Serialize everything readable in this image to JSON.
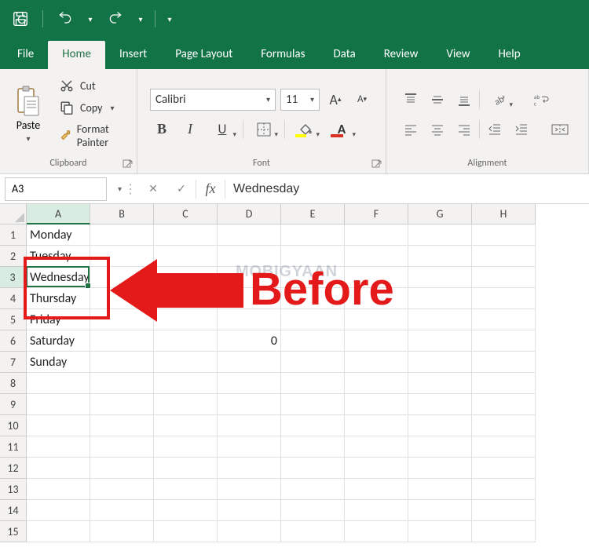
{
  "tabs": {
    "file": "File",
    "home": "Home",
    "insert": "Insert",
    "page_layout": "Page Layout",
    "formulas": "Formulas",
    "data": "Data",
    "review": "Review",
    "view": "View",
    "help": "Help"
  },
  "ribbon": {
    "clipboard": {
      "paste": "Paste",
      "cut": "Cut",
      "copy": "Copy",
      "format_painter": "Format Painter",
      "label": "Clipboard"
    },
    "font": {
      "name": "Calibri",
      "size": "11",
      "label": "Font"
    },
    "alignment": {
      "label": "Alignment"
    }
  },
  "formula_bar": {
    "name_box": "A3",
    "value": "Wednesday"
  },
  "grid": {
    "columns": [
      "A",
      "B",
      "C",
      "D",
      "E",
      "F",
      "G",
      "H"
    ],
    "row_count": 15,
    "selected_col": "A",
    "selected_row": 3,
    "cells": [
      {
        "row": 1,
        "col": "A",
        "value": "Monday"
      },
      {
        "row": 2,
        "col": "A",
        "value": "Tuesday"
      },
      {
        "row": 3,
        "col": "A",
        "value": "Wednesday"
      },
      {
        "row": 4,
        "col": "A",
        "value": "Thursday"
      },
      {
        "row": 5,
        "col": "A",
        "value": "Friday"
      },
      {
        "row": 6,
        "col": "A",
        "value": "Saturday"
      },
      {
        "row": 7,
        "col": "A",
        "value": "Sunday"
      },
      {
        "row": 6,
        "col": "D",
        "value": "0",
        "align": "right"
      }
    ]
  },
  "annotation": {
    "label": "Before",
    "watermark": "MOBIGYAAN"
  }
}
